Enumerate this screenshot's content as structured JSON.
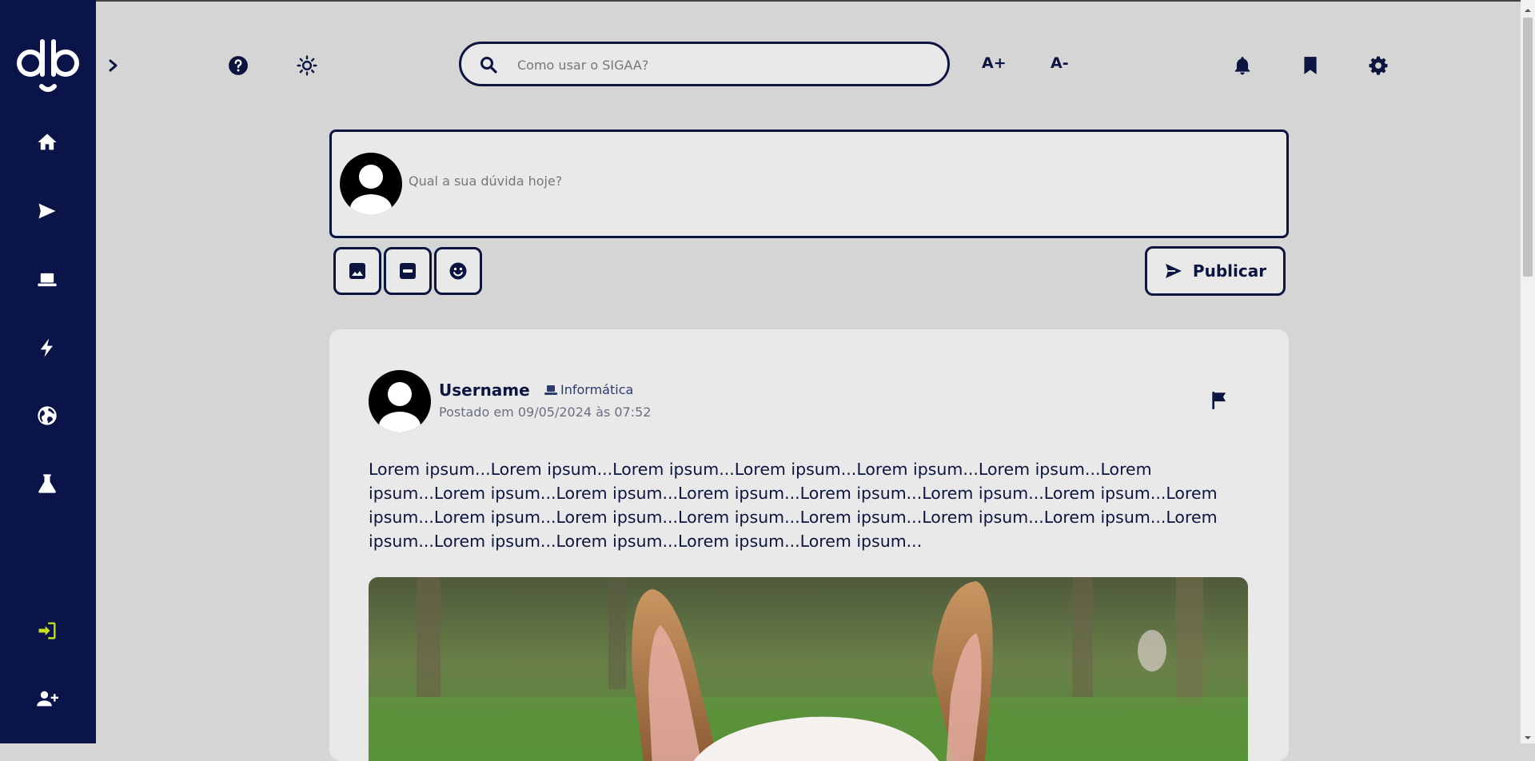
{
  "sidebar": {
    "items": [
      {
        "name": "home",
        "icon": "home-icon"
      },
      {
        "name": "send",
        "icon": "send-icon"
      },
      {
        "name": "laptop",
        "icon": "laptop-icon"
      },
      {
        "name": "bolt",
        "icon": "bolt-icon"
      },
      {
        "name": "globe",
        "icon": "globe-icon"
      },
      {
        "name": "flask",
        "icon": "flask-icon"
      }
    ],
    "bottom": [
      {
        "name": "login",
        "icon": "login-icon",
        "color": "#c6e11b"
      },
      {
        "name": "add-user",
        "icon": "user-plus-icon"
      }
    ]
  },
  "header": {
    "search_placeholder": "Como usar o SIGAA?",
    "font_increase": "A+",
    "font_decrease": "A-"
  },
  "composer": {
    "placeholder": "Qual a sua dúvida hoje?",
    "publish_label": "Publicar"
  },
  "post": {
    "username": "Username",
    "category": "Informática",
    "posted": "Postado em 09/05/2024 às 07:52",
    "body": "Lorem ipsum...Lorem ipsum...Lorem ipsum...Lorem ipsum...Lorem ipsum...Lorem ipsum...Lorem ipsum...Lorem ipsum...Lorem ipsum...Lorem ipsum...Lorem ipsum...Lorem ipsum...Lorem ipsum...Lorem ipsum...Lorem ipsum...Lorem ipsum...Lorem ipsum...Lorem ipsum...Lorem ipsum...Lorem ipsum...Lorem ipsum...Lorem ipsum...Lorem ipsum...Lorem ipsum...Lorem ipsum..."
  },
  "colors": {
    "sidebar": "#0a1449",
    "accent": "#0b1540",
    "background": "#d5d5d5",
    "card": "#e9e9e9",
    "login_icon": "#c6e11b"
  }
}
